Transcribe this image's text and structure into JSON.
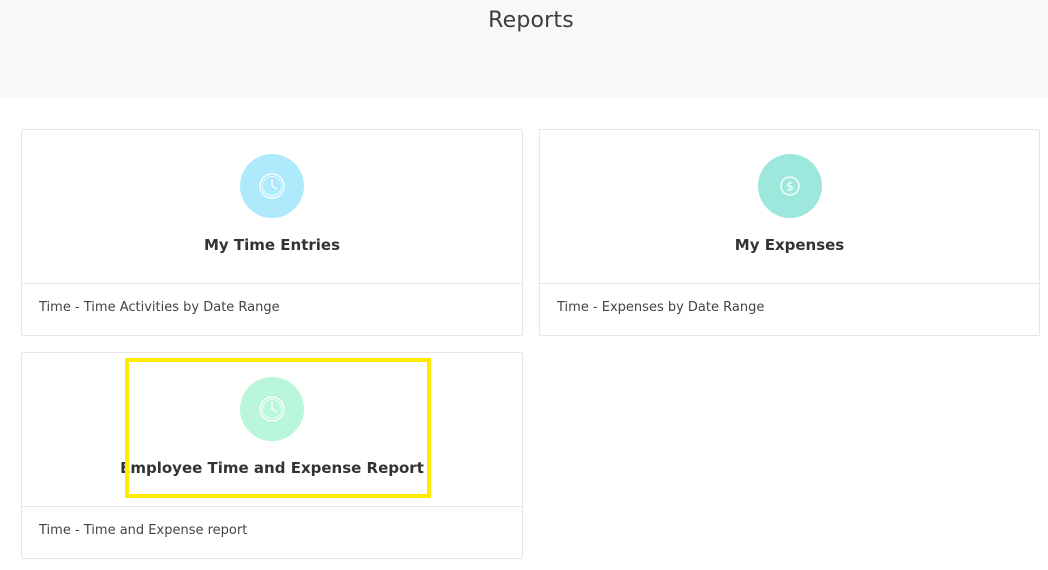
{
  "page": {
    "title": "Reports"
  },
  "cards": [
    {
      "title": "My Time Entries",
      "description": "Time - Time Activities by Date Range",
      "icon": "clock-icon",
      "icon_color": "#aeeafb"
    },
    {
      "title": "My Expenses",
      "description": "Time - Expenses by Date Range",
      "icon": "dollar-coin-icon",
      "icon_color": "#9de7dc"
    },
    {
      "title": "Employee Time and Expense Report",
      "description": "Time - Time and Expense report",
      "icon": "clock-icon",
      "icon_color": "#b9f6dc"
    }
  ],
  "highlight_color": "#ffeb00"
}
